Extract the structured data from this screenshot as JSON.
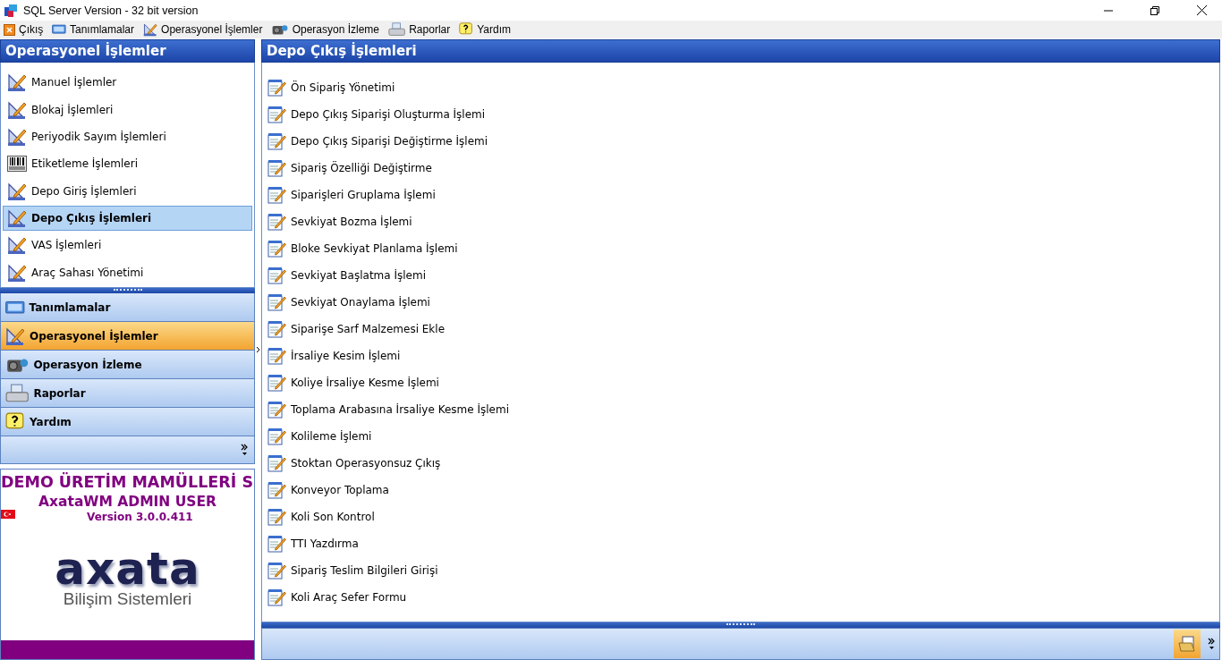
{
  "window": {
    "title": "SQL Server Version - 32 bit version"
  },
  "menu": [
    {
      "label": "Çıkış",
      "kind": "exit"
    },
    {
      "label": "Tanımlamalar",
      "kind": "keyboard"
    },
    {
      "label": "Operasyonel İşlemler",
      "kind": "tool"
    },
    {
      "label": "Operasyon İzleme",
      "kind": "camera"
    },
    {
      "label": "Raporlar",
      "kind": "printer"
    },
    {
      "label": "Yardım",
      "kind": "help"
    }
  ],
  "left_panel": {
    "title": "Operasyonel İşlemler",
    "items": [
      {
        "label": "Manuel İşlemler",
        "kind": "tool",
        "selected": false
      },
      {
        "label": "Blokaj İşlemleri",
        "kind": "tool",
        "selected": false
      },
      {
        "label": "Periyodik Sayım İşlemleri",
        "kind": "tool",
        "selected": false
      },
      {
        "label": "Etiketleme İşlemleri",
        "kind": "barcode",
        "selected": false
      },
      {
        "label": "Depo Giriş İşlemleri",
        "kind": "tool",
        "selected": false
      },
      {
        "label": "Depo Çıkış İşlemleri",
        "kind": "tool",
        "selected": true
      },
      {
        "label": "VAS İşlemleri",
        "kind": "tool",
        "selected": false
      },
      {
        "label": "Araç Sahası Yönetimi",
        "kind": "tool",
        "selected": false
      }
    ]
  },
  "nav_buttons": [
    {
      "label": "Tanımlamalar",
      "kind": "keyboard",
      "selected": false
    },
    {
      "label": "Operasyonel İşlemler",
      "kind": "tool",
      "selected": true
    },
    {
      "label": "Operasyon İzleme",
      "kind": "camera",
      "selected": false
    },
    {
      "label": "Raporlar",
      "kind": "printer",
      "selected": false
    },
    {
      "label": "Yardım",
      "kind": "help",
      "selected": false
    }
  ],
  "info": {
    "company": "DEMO ÜRETİM MAMÜLLERİ S",
    "user": "AxataWM ADMIN USER",
    "version": "Version 3.0.0.411",
    "logo": "axata",
    "logo_subtitle": "Bilişim Sistemleri"
  },
  "main": {
    "title": "Depo Çıkış İşlemleri",
    "items": [
      "Ön Sipariş Yönetimi",
      "Depo Çıkış Siparişi Oluşturma İşlemi",
      "Depo Çıkış Siparişi Değiştirme İşlemi",
      "Sipariş Özelliği Değiştirme",
      "Siparişleri Gruplama İşlemi",
      "Sevkiyat Bozma İşlemi",
      "Bloke Sevkiyat Planlama İşlemi",
      "Sevkiyat Başlatma İşlemi",
      "Sevkiyat Onaylama İşlemi",
      "Siparişe Sarf Malzemesi Ekle",
      "İrsaliye Kesim İşlemi",
      "Koliye İrsaliye Kesme İşlemi",
      "Toplama Arabasına İrsaliye Kesme İşlemi",
      "Kolileme İşlemi",
      "Stoktan Operasyonsuz Çıkış",
      "Konveyor Toplama",
      "Koli Son Kontrol",
      "TTI Yazdırma",
      "Sipariş Teslim Bilgileri Girişi",
      "Koli Araç Sefer Formu"
    ]
  }
}
